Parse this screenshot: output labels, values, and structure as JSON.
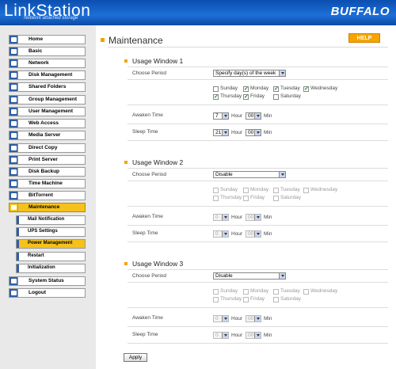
{
  "header": {
    "brand": "LinkStation",
    "tagline": "Network attached storage",
    "vendor": "BUFFALO"
  },
  "sidebar": {
    "items": [
      {
        "label": "Home"
      },
      {
        "label": "Basic"
      },
      {
        "label": "Network"
      },
      {
        "label": "Disk Management"
      },
      {
        "label": "Shared Folders"
      },
      {
        "label": "Group Management"
      },
      {
        "label": "User Management"
      },
      {
        "label": "Web Access"
      },
      {
        "label": "Media Server"
      },
      {
        "label": "Direct Copy"
      },
      {
        "label": "Print Server"
      },
      {
        "label": "Disk Backup"
      },
      {
        "label": "Time Machine"
      },
      {
        "label": "BitTorrent"
      },
      {
        "label": "Maintenance"
      }
    ],
    "subitems": [
      {
        "label": "Mail Notification"
      },
      {
        "label": "UPS Settings"
      },
      {
        "label": "Power Management"
      },
      {
        "label": "Restart"
      },
      {
        "label": "Initialization"
      }
    ],
    "bottom": [
      {
        "label": "System Status"
      },
      {
        "label": "Logout"
      }
    ]
  },
  "main": {
    "title": "Maintenance",
    "help_label": "HELP",
    "apply_label": "Apply",
    "labels": {
      "choose_period": "Choose Period",
      "awaken_time": "Awaken Time",
      "sleep_time": "Sleep Time",
      "hour": "Hour",
      "min": "Min"
    },
    "days": [
      "Sunday",
      "Monday",
      "Tuesday",
      "Wednesday",
      "Thursday",
      "Friday",
      "Saturday"
    ],
    "windows": [
      {
        "title": "Usage Window 1",
        "period": "Specify day(s) of the week",
        "checked": [
          false,
          true,
          true,
          true,
          true,
          true,
          false
        ],
        "awaken_hour": "7",
        "awaken_min": "00",
        "sleep_hour": "21",
        "sleep_min": "00",
        "enabled": true
      },
      {
        "title": "Usage Window 2",
        "period": "Disable",
        "checked": [
          false,
          false,
          false,
          false,
          false,
          false,
          false
        ],
        "awaken_hour": "0",
        "awaken_min": "00",
        "sleep_hour": "0",
        "sleep_min": "00",
        "enabled": false
      },
      {
        "title": "Usage Window 3",
        "period": "Disable",
        "checked": [
          false,
          false,
          false,
          false,
          false,
          false,
          false
        ],
        "awaken_hour": "0",
        "awaken_min": "00",
        "sleep_hour": "0",
        "sleep_min": "00",
        "enabled": false
      }
    ]
  }
}
